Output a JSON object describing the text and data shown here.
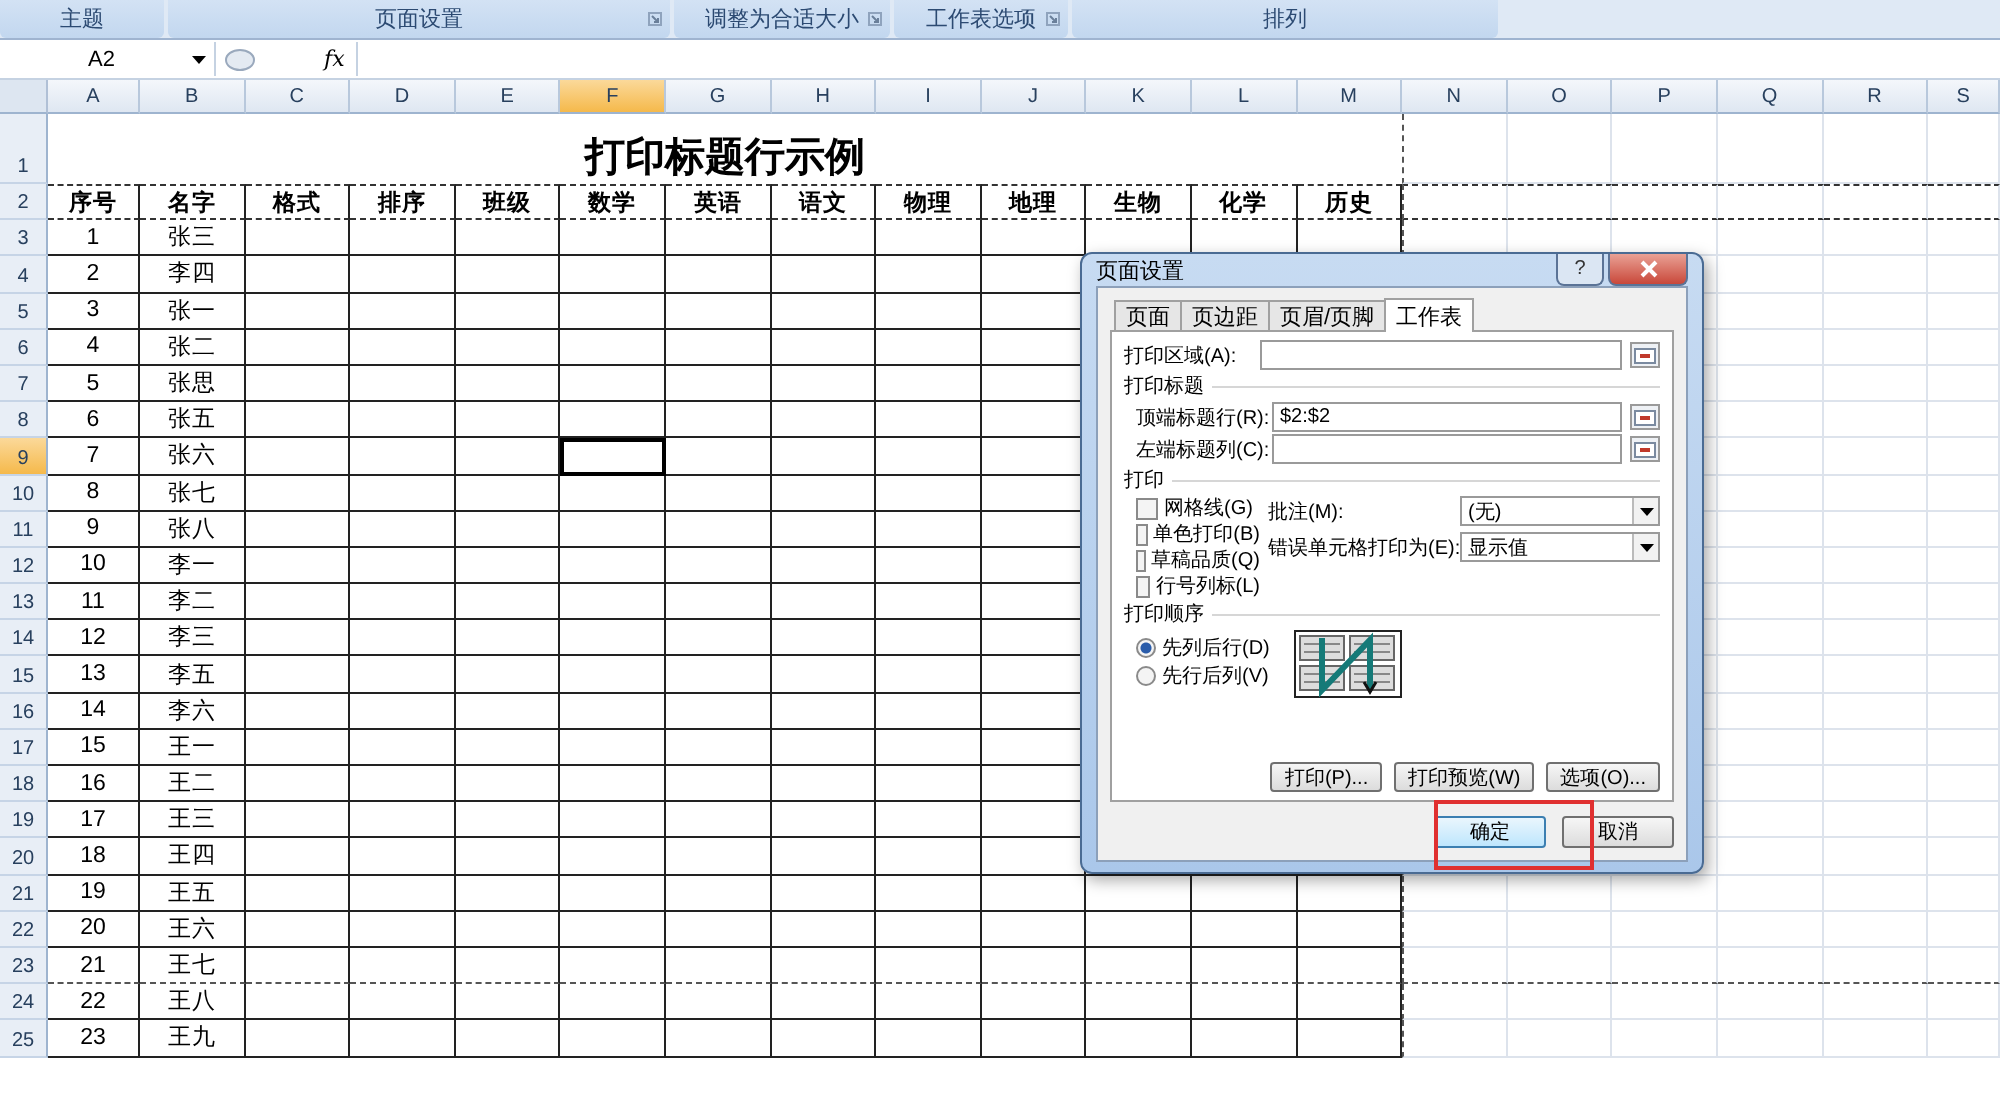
{
  "ribbon": {
    "groups": [
      {
        "label": "主题",
        "launcher": false
      },
      {
        "label": "页面设置",
        "launcher": true
      },
      {
        "label": "调整为合适大小",
        "launcher": true
      },
      {
        "label": "工作表选项",
        "launcher": true
      },
      {
        "label": "排列",
        "launcher": false
      }
    ]
  },
  "formula_bar": {
    "name_box": "A2",
    "fx": "fx"
  },
  "sheet": {
    "columns": [
      {
        "label": "A",
        "selected": false
      },
      {
        "label": "B",
        "selected": false
      },
      {
        "label": "C",
        "selected": false
      },
      {
        "label": "D",
        "selected": false
      },
      {
        "label": "E",
        "selected": false
      },
      {
        "label": "F",
        "selected": true
      },
      {
        "label": "G",
        "selected": false
      },
      {
        "label": "H",
        "selected": false
      },
      {
        "label": "I",
        "selected": false
      },
      {
        "label": "J",
        "selected": false
      },
      {
        "label": "K",
        "selected": false
      },
      {
        "label": "L",
        "selected": false
      },
      {
        "label": "M",
        "selected": false
      },
      {
        "label": "N",
        "selected": false
      },
      {
        "label": "O",
        "selected": false
      },
      {
        "label": "P",
        "selected": false
      },
      {
        "label": "Q",
        "selected": false
      },
      {
        "label": "R",
        "selected": false
      },
      {
        "label": "S",
        "selected": false
      }
    ],
    "rows": [
      {
        "label": "1",
        "selected": false
      },
      {
        "label": "2",
        "selected": false
      },
      {
        "label": "3",
        "selected": false
      },
      {
        "label": "4",
        "selected": false
      },
      {
        "label": "5",
        "selected": false
      },
      {
        "label": "6",
        "selected": false
      },
      {
        "label": "7",
        "selected": false
      },
      {
        "label": "8",
        "selected": false
      },
      {
        "label": "9",
        "selected": true
      },
      {
        "label": "10",
        "selected": false
      },
      {
        "label": "11",
        "selected": false
      },
      {
        "label": "12",
        "selected": false
      },
      {
        "label": "13",
        "selected": false
      },
      {
        "label": "14",
        "selected": false
      },
      {
        "label": "15",
        "selected": false
      },
      {
        "label": "16",
        "selected": false
      },
      {
        "label": "17",
        "selected": false
      },
      {
        "label": "18",
        "selected": false
      },
      {
        "label": "19",
        "selected": false
      },
      {
        "label": "20",
        "selected": false
      },
      {
        "label": "21",
        "selected": false
      },
      {
        "label": "22",
        "selected": false
      },
      {
        "label": "23",
        "selected": false
      },
      {
        "label": "24",
        "selected": false
      },
      {
        "label": "25",
        "selected": false
      }
    ],
    "title": "打印标题行示例",
    "header_row": [
      "序号",
      "名字",
      "格式",
      "排序",
      "班级",
      "数学",
      "英语",
      "语文",
      "物理",
      "地理",
      "生物",
      "化学",
      "历史"
    ],
    "data": [
      [
        "1",
        "张三"
      ],
      [
        "2",
        "李四"
      ],
      [
        "3",
        "张一"
      ],
      [
        "4",
        "张二"
      ],
      [
        "5",
        "张思"
      ],
      [
        "6",
        "张五"
      ],
      [
        "7",
        "张六"
      ],
      [
        "8",
        "张七"
      ],
      [
        "9",
        "张八"
      ],
      [
        "10",
        "李一"
      ],
      [
        "11",
        "李二"
      ],
      [
        "12",
        "李三"
      ],
      [
        "13",
        "李五"
      ],
      [
        "14",
        "李六"
      ],
      [
        "15",
        "王一"
      ],
      [
        "16",
        "王二"
      ],
      [
        "17",
        "王三"
      ],
      [
        "18",
        "王四"
      ],
      [
        "19",
        "王五"
      ],
      [
        "20",
        "王六"
      ],
      [
        "21",
        "王七"
      ],
      [
        "22",
        "王八"
      ],
      [
        "23",
        "王九"
      ]
    ]
  },
  "dialog": {
    "title": "页面设置",
    "help": "?",
    "tabs": [
      {
        "label": "页面",
        "selected": false
      },
      {
        "label": "页边距",
        "selected": false
      },
      {
        "label": "页眉/页脚",
        "selected": false
      },
      {
        "label": "工作表",
        "selected": true
      }
    ],
    "print_area": {
      "label": "打印区域(A):"
    },
    "print_titles": {
      "heading": "打印标题",
      "fields": [
        {
          "label": "顶端标题行(R):",
          "value": "$2:$2"
        },
        {
          "label": "左端标题列(C):"
        }
      ]
    },
    "print": {
      "heading": "打印",
      "checkboxes": [
        {
          "label": "网格线(G)",
          "checked": false
        },
        {
          "label": "单色打印(B)",
          "checked": false
        },
        {
          "label": "草稿品质(Q)",
          "checked": false
        },
        {
          "label": "行号列标(L)",
          "checked": false
        }
      ],
      "dropdowns": [
        {
          "label": "批注(M):",
          "value": "(无)"
        },
        {
          "label": "错误单元格打印为(E):",
          "value": "显示值"
        }
      ]
    },
    "page_order": {
      "heading": "打印顺序",
      "options": [
        {
          "label": "先列后行(D)",
          "selected": true
        },
        {
          "label": "先行后列(V)",
          "selected": false
        }
      ]
    },
    "action_buttons": [
      "打印(P)...",
      "打印预览(W)",
      "选项(O)..."
    ],
    "ok": "确定",
    "cancel": "取消",
    "ok_highlighted": true
  }
}
